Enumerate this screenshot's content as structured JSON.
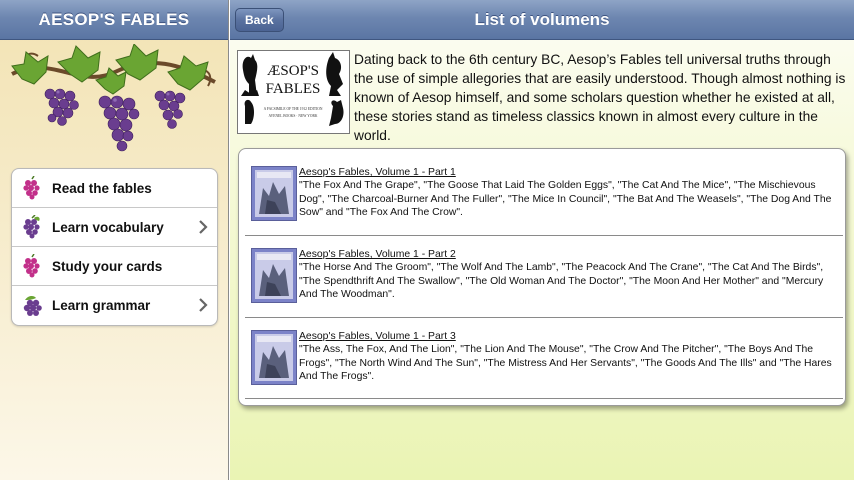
{
  "sidebar": {
    "title": "AESOP'S FABLES",
    "menu": [
      {
        "label": "Read the fables",
        "chevron": false
      },
      {
        "label": "Learn vocabulary",
        "chevron": true
      },
      {
        "label": "Study your cards",
        "chevron": false
      },
      {
        "label": "Learn grammar",
        "chevron": true
      }
    ]
  },
  "header": {
    "back_label": "Back",
    "title": "List of volumens"
  },
  "intro": {
    "text": "Dating back to the 6th century BC, Aesop’s Fables tell universal truths through the use of simple allegories that are easily understood. Though almost nothing is known of Aesop himself, and some scholars question whether he existed at all, these stories stand as timeless classics known in almost every culture in the world.",
    "cover_title_top": "ÆSOP'S",
    "cover_title_bottom": "FABLES",
    "cover_subtitle": "A FACSIMILE OF THE 1912 EDITION",
    "cover_publisher": "AVENEL BOOKS · NEW YORK"
  },
  "volumes": [
    {
      "title": "Aesop's Fables, Volume 1 - Part 1",
      "desc": "\"The Fox And The Grape\", \"The Goose That Laid The Golden Eggs\", \"The Cat And The Mice\", \"The Mischievous Dog\", \"The Charcoal-Burner And The Fuller\", \"The Mice In Council\", \"The Bat And The Weasels\", \"The Dog And The Sow\" and \"The Fox And The Crow\"."
    },
    {
      "title": "Aesop's Fables, Volume 1 - Part 2",
      "desc": "\"The Horse And The Groom\", \"The Wolf And The Lamb\", \"The Peacock And The Crane\", \"The Cat And The Birds\", \"The Spendthrift And The Swallow\", \"The Old Woman And The Doctor\", \"The Moon And Her Mother\" and \"Mercury And The Woodman\"."
    },
    {
      "title": "Aesop's Fables, Volume 1 - Part 3",
      "desc": "\"The Ass, The Fox, And The Lion\", \"The Lion And The Mouse\", \"The Crow And The Pitcher\", \"The Boys And The Frogs\", \"The North Wind And The Sun\", \"The Mistress And Her Servants\", \"The Goods And The Ills\" and \"The Hares And The Frogs\"."
    }
  ],
  "icons": {
    "menu": [
      "grapes-icon",
      "grapes-icon",
      "grapes-icon",
      "grapes-icon"
    ],
    "chevron": "chevron-right-icon"
  },
  "colors": {
    "header_blue": "#6d86b0",
    "grape_purple": "#6a3d8f",
    "leaf_green": "#5f9a2f"
  }
}
